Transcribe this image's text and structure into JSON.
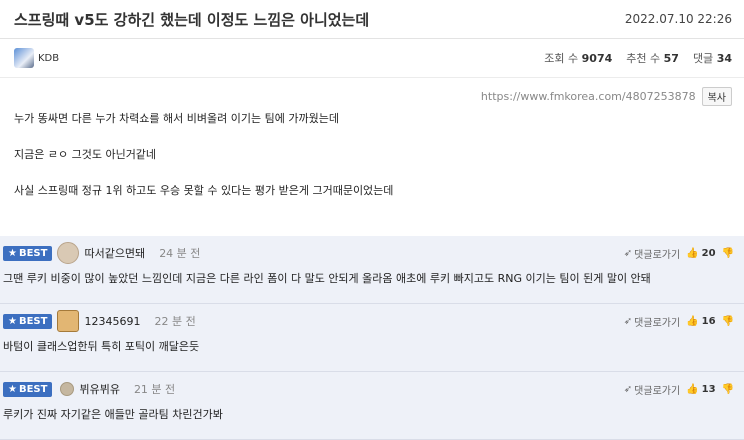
{
  "post": {
    "title": "스프링때 v5도 강하긴 했는데 이정도 느낌은 아니었는데",
    "date": "2022.07.10 22:26",
    "author": "KDB",
    "views_label": "조회 수",
    "views": "9074",
    "recommend_label": "추천 수",
    "recommend": "57",
    "comments_label": "댓글",
    "comments": "34",
    "url": "https://www.fmkorea.com/4807253878",
    "copy_label": "복사",
    "paragraphs": [
      "누가 똥싸면 다른 누가 차력쇼를 해서 비벼올려 이기는 팀에 가까웠는데",
      "지금은 ㄹㅇ 그것도 아닌거같네",
      "사실 스프링때 정규 1위 하고도 우승 못할 수 있다는 평가 받은게 그거때문이었는데"
    ]
  },
  "best_label": "BEST",
  "reply_label": "댓글로가기",
  "comments": [
    {
      "nick": "따서같으면돼",
      "time": "24 분 전",
      "votes": "20",
      "text": "그땐 루키 비중이 많이 높았던 느낌인데 지금은 다른 라인 폼이 다 말도 안되게 올라옴 애초에 루키 빠지고도 RNG 이기는 팀이 된게 말이 안돼"
    },
    {
      "nick": "12345691",
      "time": "22 분 전",
      "votes": "16",
      "text": "바텀이 클래스업한뒤 특히 포틱이 깨달은듯"
    },
    {
      "nick": "뷔유뷔유",
      "time": "21 분 전",
      "votes": "13",
      "text": "루키가 진짜 자기같은 애들만 골라팀 차린건가봐"
    }
  ]
}
